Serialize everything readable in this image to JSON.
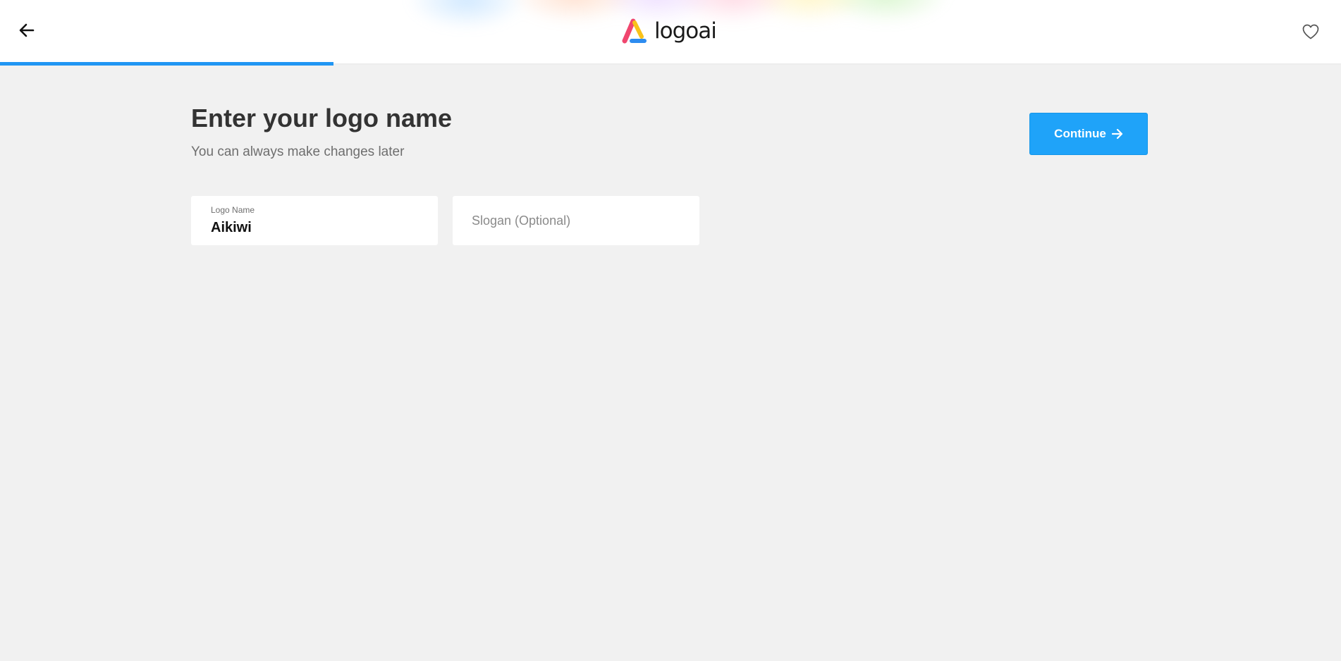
{
  "header": {
    "brand": "logoai",
    "back_icon": "arrow-left-icon",
    "favorite_icon": "heart-outline-icon"
  },
  "progress": {
    "fraction": 0.25,
    "color": "#2196f3"
  },
  "main": {
    "title": "Enter your logo name",
    "subtitle": "You can always make changes later",
    "continue_label": "Continue",
    "continue_icon": "arrow-right-icon"
  },
  "form": {
    "logo_name": {
      "label": "Logo Name",
      "value": "Aikiwi"
    },
    "slogan": {
      "placeholder": "Slogan (Optional)",
      "value": ""
    }
  },
  "colors": {
    "accent": "#1fa3f9",
    "background": "#f1f1f1",
    "logo_pink": "#f0466e",
    "logo_yellow": "#f9c21a",
    "logo_blue": "#2d8cf0"
  }
}
